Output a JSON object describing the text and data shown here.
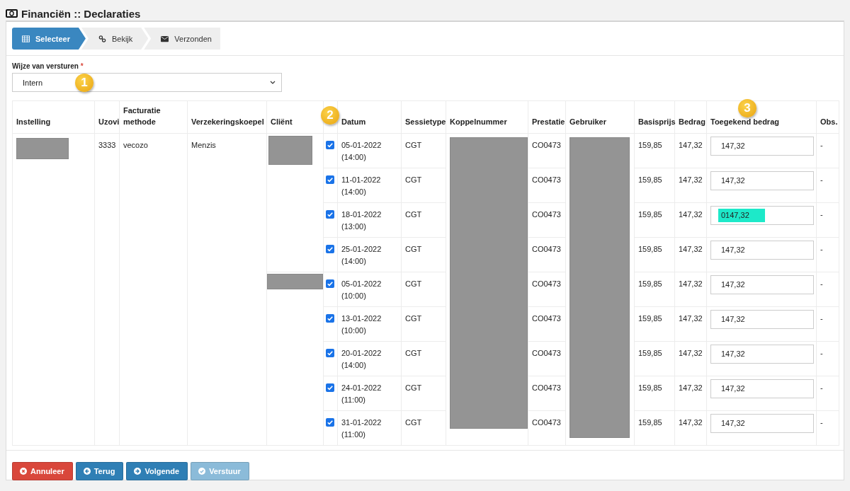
{
  "page_title": "Financiën :: Declaraties",
  "steps": [
    {
      "label": "Selecteer",
      "kind": "grid",
      "selected": true
    },
    {
      "label": "Bekijk",
      "kind": "link",
      "selected": false
    },
    {
      "label": "Verzonden",
      "kind": "mail",
      "selected": false
    }
  ],
  "send_method": {
    "label": "Wijze van versturen",
    "required_mark": "*",
    "value": "Intern"
  },
  "annotations": [
    "1",
    "2",
    "3"
  ],
  "table": {
    "columns": [
      "Instelling",
      "Uzovi",
      "Facturatie methode",
      "Verzekeringskoepel",
      "Cliënt",
      "",
      "Datum",
      "Sessietype",
      "Koppelnummer",
      "Prestatie",
      "Gebruiker",
      "Basisprijs",
      "Bedrag",
      "Toegekend bedrag",
      "Obs."
    ],
    "uzovi": "3333",
    "method": "vecozo",
    "koepel": "Menzis",
    "clients": [
      {
        "sessions": [
          {
            "checked": true,
            "date": "05-01-2022",
            "time": "(14:00)",
            "type": "CGT",
            "prestatie": "CO0473",
            "basisprijs": "159,85",
            "bedrag": "147,32",
            "toegekend": "147,32",
            "highlighted": false,
            "obs": "-"
          },
          {
            "checked": true,
            "date": "11-01-2022",
            "time": "(14:00)",
            "type": "CGT",
            "prestatie": "CO0473",
            "basisprijs": "159,85",
            "bedrag": "147,32",
            "toegekend": "147,32",
            "highlighted": false,
            "obs": "-"
          },
          {
            "checked": true,
            "date": "18-01-2022",
            "time": "(13:00)",
            "type": "CGT",
            "prestatie": "CO0473",
            "basisprijs": "159,85",
            "bedrag": "147,32",
            "toegekend": "0147,32",
            "highlighted": true,
            "obs": "-"
          },
          {
            "checked": true,
            "date": "25-01-2022",
            "time": "(14:00)",
            "type": "CGT",
            "prestatie": "CO0473",
            "basisprijs": "159,85",
            "bedrag": "147,32",
            "toegekend": "147,32",
            "highlighted": false,
            "obs": "-"
          }
        ]
      },
      {
        "sessions": [
          {
            "checked": true,
            "date": "05-01-2022",
            "time": "(10:00)",
            "type": "CGT",
            "prestatie": "CO0473",
            "basisprijs": "159,85",
            "bedrag": "147,32",
            "toegekend": "147,32",
            "highlighted": false,
            "obs": "-"
          },
          {
            "checked": true,
            "date": "13-01-2022",
            "time": "(10:00)",
            "type": "CGT",
            "prestatie": "CO0473",
            "basisprijs": "159,85",
            "bedrag": "147,32",
            "toegekend": "147,32",
            "highlighted": false,
            "obs": "-"
          },
          {
            "checked": true,
            "date": "20-01-2022",
            "time": "(14:00)",
            "type": "CGT",
            "prestatie": "CO0473",
            "basisprijs": "159,85",
            "bedrag": "147,32",
            "toegekend": "147,32",
            "highlighted": false,
            "obs": "-"
          },
          {
            "checked": true,
            "date": "24-01-2022",
            "time": "(11:00)",
            "type": "CGT",
            "prestatie": "CO0473",
            "basisprijs": "159,85",
            "bedrag": "147,32",
            "toegekend": "147,32",
            "highlighted": false,
            "obs": "-"
          },
          {
            "checked": true,
            "date": "31-01-2022",
            "time": "(11:00)",
            "type": "CGT",
            "prestatie": "CO0473",
            "basisprijs": "159,85",
            "bedrag": "147,32",
            "toegekend": "147,32",
            "highlighted": false,
            "obs": "-"
          }
        ]
      }
    ]
  },
  "buttons": [
    {
      "label": "Annuleer",
      "kind": "cancel",
      "disabled": false
    },
    {
      "label": "Terug",
      "kind": "back",
      "disabled": false
    },
    {
      "label": "Volgende",
      "kind": "next",
      "disabled": false
    },
    {
      "label": "Verstuur",
      "kind": "send",
      "disabled": true
    }
  ]
}
